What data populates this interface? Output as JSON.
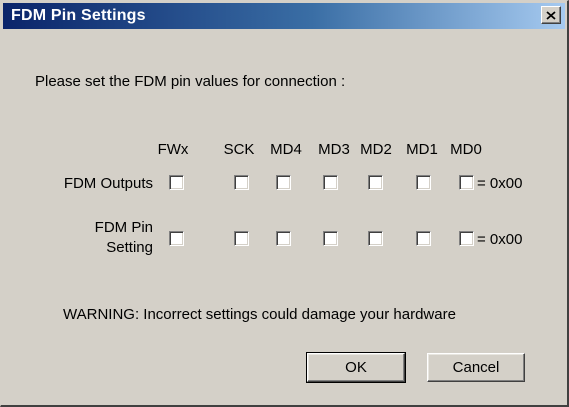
{
  "window": {
    "title": "FDM Pin Settings",
    "close_glyph": "✕"
  },
  "prompt": "Please set the FDM pin values for connection :",
  "columns": [
    "FWx",
    "SCK",
    "MD4",
    "MD3",
    "MD2",
    "MD1",
    "MD0"
  ],
  "rows": [
    {
      "label_line1": "FDM Outputs",
      "label_line2": "",
      "checked": [
        false,
        false,
        false,
        false,
        false,
        false,
        false
      ],
      "value": "= 0x00"
    },
    {
      "label_line1": "FDM Pin",
      "label_line2": "Setting",
      "checked": [
        false,
        false,
        false,
        false,
        false,
        false,
        false
      ],
      "value": "= 0x00"
    }
  ],
  "warning": "WARNING: Incorrect settings could damage your hardware",
  "buttons": {
    "ok_label": "OK",
    "cancel_label": "Cancel"
  }
}
